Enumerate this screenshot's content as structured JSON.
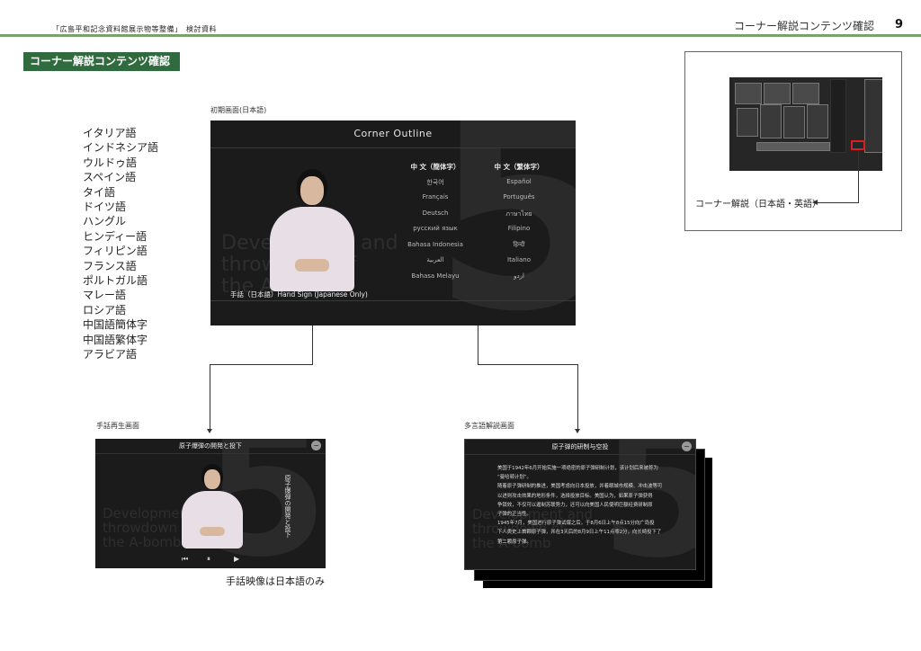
{
  "header": {
    "left_text": "「広島平和記念資料館展示物等整備」　検討資料",
    "right_text": "コーナー解説コンテンツ確認",
    "page_number": "9"
  },
  "title": "コーナー解説コンテンツ確認",
  "languages": [
    "イタリア語",
    "インドネシア語",
    "ウルドゥ語",
    "スペイン語",
    "タイ語",
    "ドイツ語",
    "ハングル",
    "ヒンディー語",
    "フィリピン語",
    "フランス語",
    "ポルトガル語",
    "マレー語",
    "ロシア語",
    "中国語簡体字",
    "中国語繁体字",
    "アラビア語"
  ],
  "main_screen": {
    "label": "初期画面(日本語)",
    "title": "Corner Outline",
    "caption": "手話（日本語）Hand Sign (Japanese Only)",
    "col_a": [
      "中 文（簡体字）",
      "한국어",
      "Français",
      "Deutsch",
      "русский язык",
      "Bahasa Indonesia",
      "العربية",
      "Bahasa Melayu"
    ],
    "col_b": [
      "中 文（繁体字）",
      "Español",
      "Português",
      "ภาษาไทย",
      "Filipino",
      "हिन्दी",
      "Italiano",
      "اردو"
    ]
  },
  "thumbnail": {
    "label": "コーナー解説（日本語・英語）"
  },
  "sign_screen": {
    "label": "手話再生画面",
    "title": "原子爆弾の開発と投下",
    "vertical_text": "原子爆弾の開発と投下",
    "caption": "手話映像は日本語のみ",
    "close_icon": "close-icon",
    "controls": [
      "prev-icon",
      "pause-icon",
      "next-icon"
    ]
  },
  "multi_screen": {
    "label": "多言語解説画面",
    "title": "原子弹的研制与空投",
    "body": [
      "美国于1942年6月开始实施一项绝密的原子弹研制计划，该计划后来被称为",
      "“曼哈顿计划”。",
      "随着原子弹研制的推进，美国考虑向日本投放，并着眼城市规模、冲击波等可",
      "以进则攻击效果的地形条件，选择投放目标。美国认为，如果原子弹获得",
      "争锁效，不仅可以遏制苏联势力，还可以向美国人民使明巨额经费研制原",
      "子弹的正当性。",
      "1945年7月，美国进行原子弹试爆之后，于8月6日上午8点15分向广岛投",
      "下人类史上首颗原子弹，并在3天后的8月9日上午11点零2分，向长崎投下了",
      "第二颗原子弹。"
    ]
  },
  "background_text": {
    "english": [
      "Development and",
      "throwdown of",
      "the A-bomb"
    ],
    "number": "5"
  },
  "colors": {
    "header_rule": "#7aa36a",
    "title_box": "#2f6b3e",
    "highlight": "#d52020"
  }
}
